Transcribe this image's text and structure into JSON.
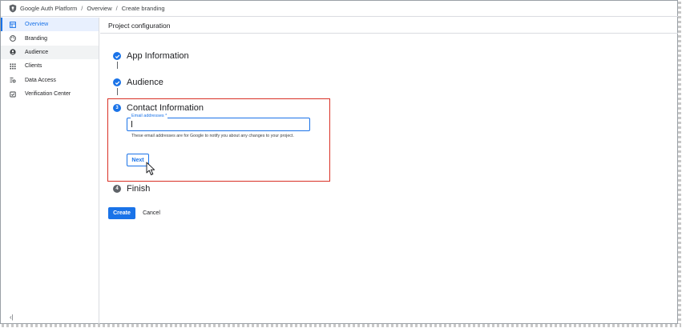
{
  "breadcrumb": {
    "icon": "shield-icon",
    "items": [
      "Google Auth Platform",
      "Overview",
      "Create branding"
    ],
    "separator": "/"
  },
  "sidebar": {
    "items": [
      {
        "label": "Overview",
        "icon": "dashboard-icon",
        "state": "active"
      },
      {
        "label": "Branding",
        "icon": "palette-icon",
        "state": "normal"
      },
      {
        "label": "Audience",
        "icon": "person-icon",
        "state": "hover"
      },
      {
        "label": "Clients",
        "icon": "grid-icon",
        "state": "normal"
      },
      {
        "label": "Data Access",
        "icon": "data-access-icon",
        "state": "normal"
      },
      {
        "label": "Verification Center",
        "icon": "verification-icon",
        "state": "normal"
      }
    ],
    "collapse_icon": "‹|"
  },
  "main": {
    "title": "Project configuration",
    "steps": [
      {
        "title": "App Information",
        "status": "done",
        "marker": ""
      },
      {
        "title": "Audience",
        "status": "done",
        "marker": ""
      },
      {
        "title": "Contact Information",
        "status": "current",
        "marker": "3"
      },
      {
        "title": "Finish",
        "status": "pending",
        "marker": "4"
      }
    ],
    "contact": {
      "field_label": "Email addresses *",
      "field_value": "",
      "hint": "These email addresses are for Google to notify you about any changes to your project.",
      "next_label": "Next"
    },
    "create_label": "Create",
    "cancel_label": "Cancel"
  },
  "colors": {
    "accent": "#1a73e8",
    "highlight": "#d93025",
    "pending": "#5f6368"
  }
}
